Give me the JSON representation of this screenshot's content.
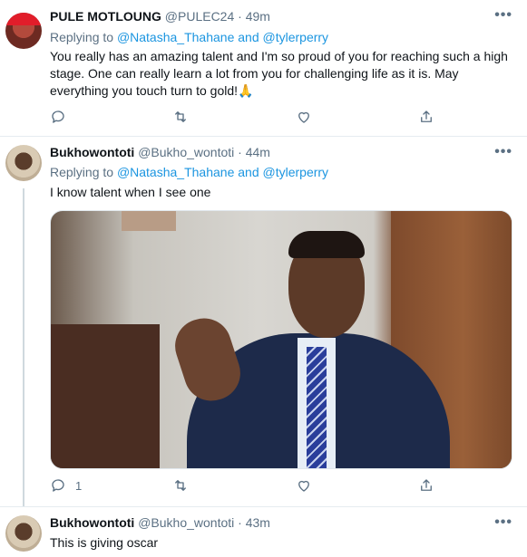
{
  "tweets": [
    {
      "name": "PULE MOTLOUNG",
      "handle": "@PULEC24",
      "time": "49m",
      "replying_prefix": "Replying to",
      "replying_user1": "@Natasha_Thahane",
      "replying_and": "and",
      "replying_user2": "@tylerperry",
      "text": "You really has an amazing talent and I'm so proud of you for reaching such a high stage. One can really learn a lot from you for challenging life as it is. May everything you touch turn to gold!🙏",
      "reply_count": "",
      "more": "•••"
    },
    {
      "name": "Bukhowontoti",
      "handle": "@Bukho_wontoti",
      "time": "44m",
      "replying_prefix": "Replying to",
      "replying_user1": "@Natasha_Thahane",
      "replying_and": "and",
      "replying_user2": "@tylerperry",
      "text": "I know talent when I see one",
      "reply_count": "1",
      "more": "•••"
    },
    {
      "name": "Bukhowontoti",
      "handle": "@Bukho_wontoti",
      "time": "43m",
      "text": "This is giving oscar",
      "more": "•••"
    }
  ],
  "separator": "·",
  "icons": [
    "reply-icon",
    "retweet-icon",
    "like-icon",
    "share-icon",
    "more-icon"
  ],
  "colors": {
    "link": "#1b95e0",
    "secondary_text": "#5b7083",
    "divider": "#e6ecf0"
  }
}
